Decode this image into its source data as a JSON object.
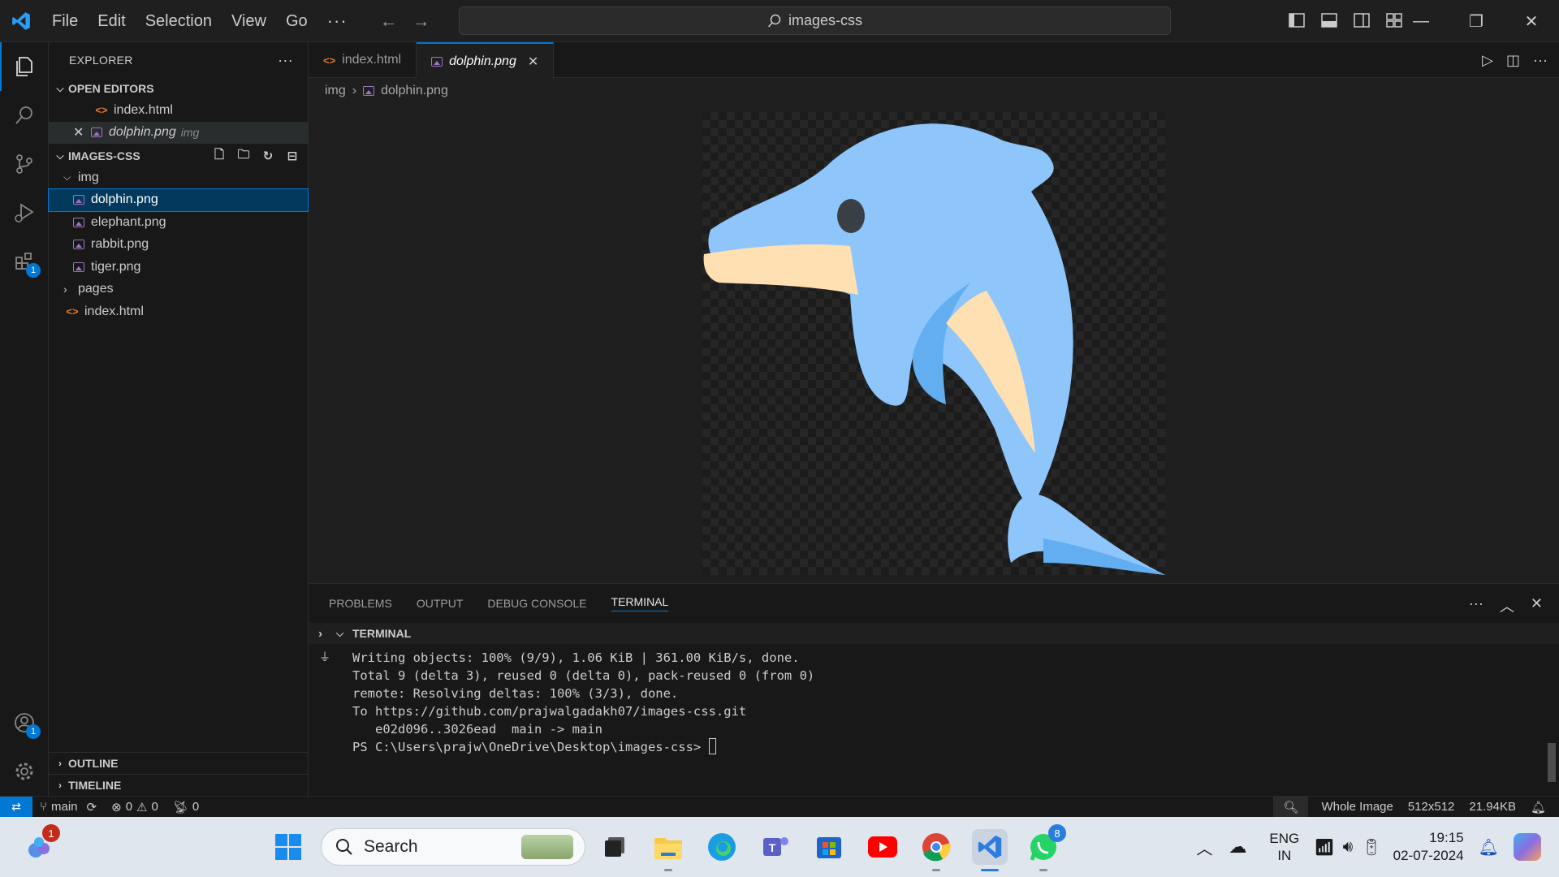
{
  "titlebar": {
    "menu": [
      "File",
      "Edit",
      "Selection",
      "View",
      "Go"
    ],
    "more": "···",
    "command_center": "images-css"
  },
  "activity_bar": {
    "extensions_badge": "1",
    "accounts_badge": "1"
  },
  "sidebar": {
    "header": "EXPLORER",
    "open_editors": {
      "title": "OPEN EDITORS",
      "items": [
        {
          "name": "index.html"
        },
        {
          "name": "dolphin.png",
          "folder": "img"
        }
      ]
    },
    "project": {
      "title": "IMAGES-CSS",
      "folder_img": "img",
      "img_files": [
        "dolphin.png",
        "elephant.png",
        "rabbit.png",
        "tiger.png"
      ],
      "folder_pages": "pages",
      "root_file": "index.html"
    },
    "outline": "OUTLINE",
    "timeline": "TIMELINE"
  },
  "editor": {
    "tabs": [
      {
        "label": "index.html"
      },
      {
        "label": "dolphin.png"
      }
    ],
    "breadcrumb": {
      "folder": "img",
      "file": "dolphin.png"
    }
  },
  "panel": {
    "tabs": [
      "PROBLEMS",
      "OUTPUT",
      "DEBUG CONSOLE",
      "TERMINAL"
    ],
    "terminal_title": "TERMINAL",
    "lines": [
      "Writing objects: 100% (9/9), 1.06 KiB | 361.00 KiB/s, done.",
      "Total 9 (delta 3), reused 0 (delta 0), pack-reused 0 (from 0)",
      "remote: Resolving deltas: 100% (3/3), done.",
      "To https://github.com/prajwalgadakh07/images-css.git",
      "   e02d096..3026ead  main -> main",
      "PS C:\\Users\\prajw\\OneDrive\\Desktop\\images-css> "
    ]
  },
  "statusbar": {
    "branch": "main",
    "errors": "0",
    "warnings": "0",
    "ports": "0",
    "zoom_label": "Whole Image",
    "dimensions": "512x512",
    "filesize": "21.94KB"
  },
  "taskbar": {
    "search_placeholder": "Search",
    "copilot_badge": "1",
    "whatsapp_badge": "8",
    "lang_top": "ENG",
    "lang_bottom": "IN",
    "time": "19:15",
    "date": "02-07-2024"
  },
  "colors": {
    "accent": "#0078d4",
    "dolphin_body": "#8ec5fb",
    "dolphin_belly": "#ffe0b3",
    "dolphin_shade": "#62aef0"
  }
}
